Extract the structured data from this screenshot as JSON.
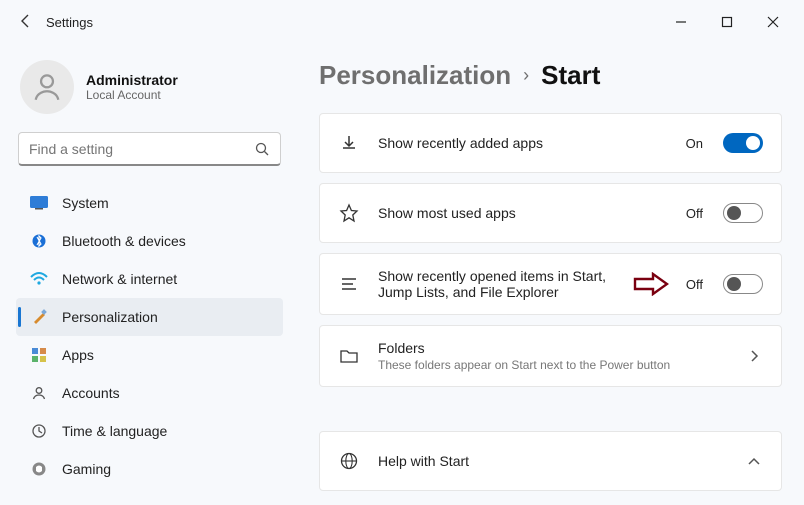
{
  "window": {
    "title": "Settings"
  },
  "user": {
    "name": "Administrator",
    "sub": "Local Account"
  },
  "search": {
    "placeholder": "Find a setting"
  },
  "sidebar": {
    "items": [
      {
        "label": "System"
      },
      {
        "label": "Bluetooth & devices"
      },
      {
        "label": "Network & internet"
      },
      {
        "label": "Personalization"
      },
      {
        "label": "Apps"
      },
      {
        "label": "Accounts"
      },
      {
        "label": "Time & language"
      },
      {
        "label": "Gaming"
      }
    ]
  },
  "breadcrumb": {
    "parent": "Personalization",
    "current": "Start"
  },
  "settings": {
    "recent_apps": {
      "title": "Show recently added apps",
      "state": "On"
    },
    "most_used": {
      "title": "Show most used apps",
      "state": "Off"
    },
    "recent_items": {
      "title": "Show recently opened items in Start, Jump Lists, and File Explorer",
      "state": "Off"
    },
    "folders": {
      "title": "Folders",
      "sub": "These folders appear on Start next to the Power button"
    },
    "help": {
      "title": "Help with Start"
    }
  }
}
